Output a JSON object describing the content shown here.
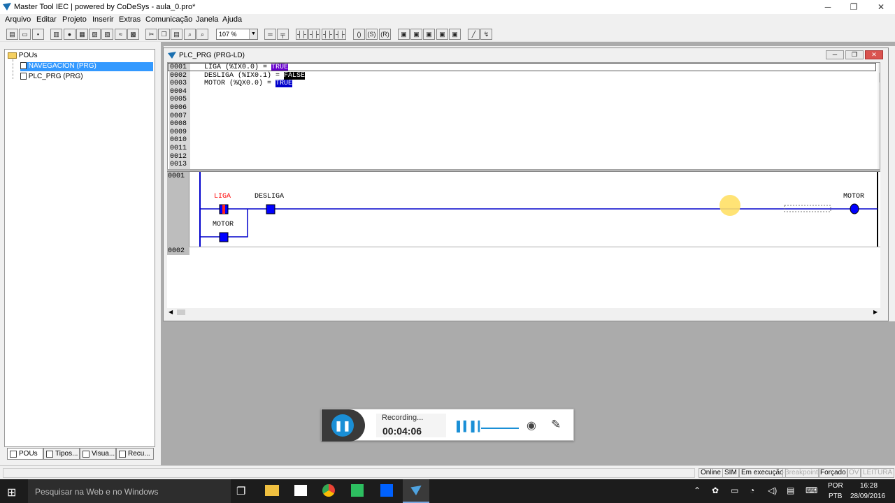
{
  "window": {
    "title": "Master Tool IEC | powered by CoDeSys - aula_0.pro*",
    "minimize": "─",
    "maximize": "❐",
    "close": "✕"
  },
  "menu": [
    "Arquivo",
    "Editar",
    "Projeto",
    "Inserir",
    "Extras",
    "Comunicação",
    "Janela",
    "Ajuda"
  ],
  "toolbar": {
    "zoom": "107 %"
  },
  "tree": {
    "root": "POUs",
    "items": [
      {
        "label": "NAVEGACION (PRG)",
        "selected": true
      },
      {
        "label": "PLC_PRG (PRG)",
        "selected": false
      }
    ]
  },
  "left_tabs": [
    "POUs",
    "Tipos...",
    "Visua...",
    "Recu..."
  ],
  "editor": {
    "title": "PLC_PRG (PRG-LD)",
    "decl_lines": [
      "0001",
      "0002",
      "0003",
      "0004",
      "0005",
      "0006",
      "0007",
      "0008",
      "0009",
      "0010",
      "0011",
      "0012",
      "0013"
    ],
    "vars": [
      {
        "text": "LIGA (%IX0.0) = ",
        "value": "TRUE"
      },
      {
        "text": "DESLIGA (%IX0.1) = ",
        "value": "FALSE"
      },
      {
        "text": "MOTOR (%QX0.0) = ",
        "value": "TRUE"
      }
    ],
    "networks": [
      "0001",
      "0002"
    ],
    "contacts": {
      "liga": "LIGA",
      "desliga": "DESLIGA",
      "motor_contact": "MOTOR",
      "motor_coil": "MOTOR"
    }
  },
  "recording": {
    "status": "Recording...",
    "time": "00:04:06"
  },
  "status": {
    "items": [
      "Online",
      "SIM",
      "Em execução",
      "Breakpoint",
      "Forçado",
      "OV",
      "LEITURA"
    ]
  },
  "taskbar": {
    "search": "Pesquisar na Web e no Windows",
    "lang": "POR",
    "layout": "PTB",
    "time": "16:28",
    "date": "28/09/2016"
  },
  "colors": {
    "selected": "#3399ff",
    "coil_blue": "#0000ff",
    "liga_red": "#ff0000"
  }
}
